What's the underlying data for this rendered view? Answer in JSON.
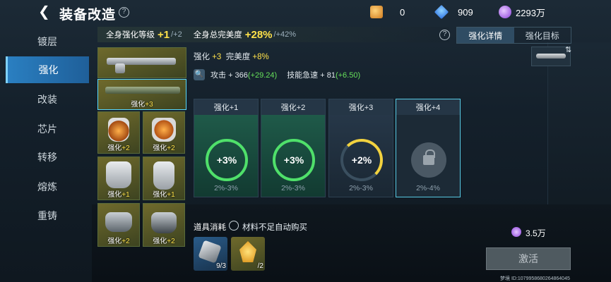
{
  "header": {
    "title": "装备改造"
  },
  "resources": [
    {
      "icon": "coin-chest-icon",
      "value": "0"
    },
    {
      "icon": "blue-gem-icon",
      "value": "909"
    },
    {
      "icon": "purple-crystal-icon",
      "value": "2293万"
    }
  ],
  "sidebar": {
    "items": [
      {
        "label": "镀层",
        "active": false
      },
      {
        "label": "强化",
        "active": true
      },
      {
        "label": "改装",
        "active": false
      },
      {
        "label": "芯片",
        "active": false
      },
      {
        "label": "转移",
        "active": false
      },
      {
        "label": "熔炼",
        "active": false
      },
      {
        "label": "重铸",
        "active": false
      }
    ]
  },
  "stats": {
    "level_label": "全身强化等级",
    "level_value": "+1",
    "level_next": "/+2",
    "perfect_label": "全身总完美度",
    "perfect_value": "+28%",
    "perfect_next": "/+42%"
  },
  "tabs": [
    {
      "label": "强化详情",
      "active": true
    },
    {
      "label": "强化目标",
      "active": false
    }
  ],
  "equipment": [
    {
      "label": "",
      "level": ""
    },
    {
      "label": "强化",
      "level": "+3"
    },
    {
      "label": "强化",
      "level": "+2"
    },
    {
      "label": "强化",
      "level": "+2"
    },
    {
      "label": "强化",
      "level": "+1"
    },
    {
      "label": "强化",
      "level": "+1"
    },
    {
      "label": "强化",
      "level": "+2"
    },
    {
      "label": "强化",
      "level": "+2"
    }
  ],
  "summary": {
    "enh_label": "强化",
    "enh_value": "+3",
    "perfect_label": "完美度",
    "perfect_value": "+8%"
  },
  "detail": {
    "attack_label": "攻击",
    "attack_value": "+ 366",
    "attack_bonus": "(+29.24)",
    "skill_label": "技能急速",
    "skill_value": "+ 81",
    "skill_bonus": "(+6.50)"
  },
  "upgrades": [
    {
      "title": "强化+1",
      "value": "+3%",
      "range": "2%-3%",
      "state": "done",
      "ring_color": "#4fe06a"
    },
    {
      "title": "强化+2",
      "value": "+3%",
      "range": "2%-3%",
      "state": "done",
      "ring_color": "#4fe06a"
    },
    {
      "title": "强化+3",
      "value": "+2%",
      "range": "2%-3%",
      "state": "current",
      "ring_color": "#f2d23f"
    },
    {
      "title": "强化+4",
      "value": "",
      "range": "2%-4%",
      "state": "locked",
      "ring_color": "#9aa4ac"
    }
  ],
  "materials": {
    "title": "道具消耗",
    "auto_buy_label": "材料不足自动购买",
    "items": [
      {
        "icon": "metal-part-icon",
        "count": "9/3"
      },
      {
        "icon": "yellow-crystal-icon",
        "count": "/2"
      }
    ]
  },
  "cost": {
    "value": "3.5万"
  },
  "activate_label": "激活",
  "uid": "梦境 ID:1079958680264864045"
}
